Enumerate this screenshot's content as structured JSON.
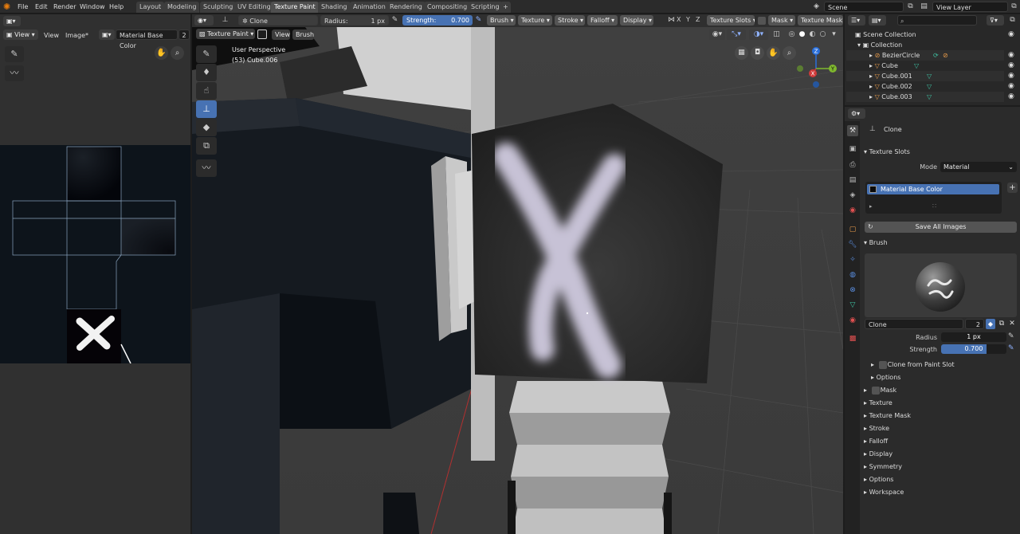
{
  "menu": [
    "File",
    "Edit",
    "Render",
    "Window",
    "Help"
  ],
  "workspaces": [
    {
      "label": "Layout"
    },
    {
      "label": "Modeling"
    },
    {
      "label": "Sculpting"
    },
    {
      "label": "UV Editing"
    },
    {
      "label": "Texture Paint",
      "active": true
    },
    {
      "label": "Shading"
    },
    {
      "label": "Animation"
    },
    {
      "label": "Rendering"
    },
    {
      "label": "Compositing"
    },
    {
      "label": "Scripting"
    }
  ],
  "add_tab": "+",
  "scene": {
    "label": "Scene"
  },
  "view_layer": {
    "label": "View Layer"
  },
  "image_editor": {
    "view": "View",
    "view2": "View",
    "image": "Image*",
    "image_name": "Material Base Color",
    "users": "2"
  },
  "viewport": {
    "brush_name": "Clone",
    "radius_label": "Radius:",
    "radius_value": "1 px",
    "strength_label": "Strength:",
    "strength_value": "0.700",
    "brush_menu": "Brush",
    "texture_menu": "Texture",
    "stroke_menu": "Stroke",
    "falloff_menu": "Falloff",
    "display_menu": "Display",
    "axes": [
      "X",
      "Y",
      "Z"
    ],
    "texture_slots": "Texture Slots",
    "mask": "Mask",
    "texture_mask": "Texture Mask",
    "mode": "Texture Paint",
    "view": "View",
    "brush": "Brush",
    "perspective": "User Perspective",
    "object": "(53) Cube.006",
    "gizmo_axes": {
      "x": "X",
      "y": "Y",
      "z": "Z"
    }
  },
  "outliner": {
    "search_placeholder": "",
    "scene_collection": "Scene Collection",
    "collection": "Collection",
    "items": [
      {
        "name": "BezierCircle"
      },
      {
        "name": "Cube"
      },
      {
        "name": "Cube.001"
      },
      {
        "name": "Cube.002"
      },
      {
        "name": "Cube.003"
      }
    ]
  },
  "properties": {
    "tool_name": "Clone",
    "texture_slots": "Texture Slots",
    "mode_label": "Mode",
    "mode_value": "Material",
    "slot_item": "Material Base Color",
    "save_all": "Save All Images",
    "brush_section": "Brush",
    "brush_name": "Clone",
    "brush_users": "2",
    "radius_label": "Radius",
    "radius_value": "1 px",
    "strength_label": "Strength",
    "strength_value": "0.700",
    "strength_fraction": 0.7,
    "clone_from_slot": "Clone from Paint Slot",
    "options_sub": "Options",
    "sections": [
      "Mask",
      "Texture",
      "Texture Mask",
      "Stroke",
      "Falloff",
      "Display",
      "Symmetry",
      "Options",
      "Workspace"
    ]
  },
  "colors": {
    "accent": "#4772b3",
    "active_tab": "#4f4f4f",
    "viewport_bg": "#393939",
    "uv_bg": "#0d141b"
  }
}
